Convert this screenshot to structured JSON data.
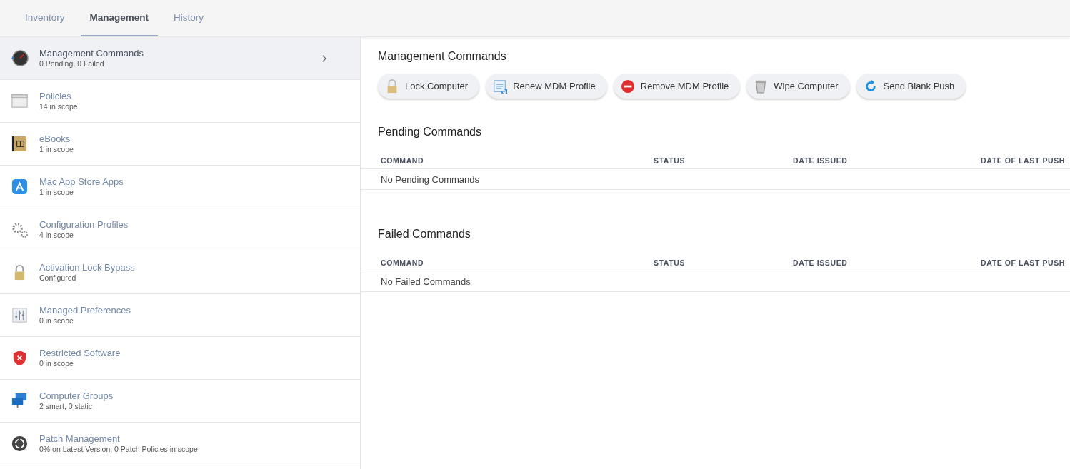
{
  "tabs": [
    {
      "label": "Inventory",
      "selected": false
    },
    {
      "label": "Management",
      "selected": true
    },
    {
      "label": "History",
      "selected": false
    }
  ],
  "sidebar": {
    "items": [
      {
        "kind": "commands",
        "title": "Management Commands",
        "subtitle": "0 Pending, 0 Failed",
        "selected": true
      },
      {
        "kind": "policies",
        "title": "Policies",
        "subtitle": "14 in scope",
        "selected": false
      },
      {
        "kind": "ebooks",
        "title": "eBooks",
        "subtitle": "1 in scope",
        "selected": false
      },
      {
        "kind": "appstore",
        "title": "Mac App Store Apps",
        "subtitle": "1 in scope",
        "selected": false
      },
      {
        "kind": "profiles",
        "title": "Configuration Profiles",
        "subtitle": "4 in scope",
        "selected": false
      },
      {
        "kind": "bypass",
        "title": "Activation Lock Bypass",
        "subtitle": "Configured",
        "selected": false
      },
      {
        "kind": "preferences",
        "title": "Managed Preferences",
        "subtitle": "0 in scope",
        "selected": false
      },
      {
        "kind": "restricted",
        "title": "Restricted Software",
        "subtitle": "0 in scope",
        "selected": false
      },
      {
        "kind": "groups",
        "title": "Computer Groups",
        "subtitle": "2 smart, 0 static",
        "selected": false
      },
      {
        "kind": "patch",
        "title": "Patch Management",
        "subtitle": "0% on Latest Version, 0 Patch Policies in scope",
        "selected": false
      }
    ]
  },
  "main": {
    "title": "Management Commands",
    "buttons": [
      {
        "kind": "lock",
        "label": "Lock Computer"
      },
      {
        "kind": "renew",
        "label": "Renew MDM Profile"
      },
      {
        "kind": "remove",
        "label": "Remove MDM Profile"
      },
      {
        "kind": "wipe",
        "label": "Wipe Computer"
      },
      {
        "kind": "push",
        "label": "Send Blank Push"
      }
    ],
    "sections": [
      {
        "title": "Pending Commands",
        "columns": [
          "COMMAND",
          "STATUS",
          "DATE ISSUED",
          "DATE OF LAST PUSH"
        ],
        "empty": "No Pending Commands"
      },
      {
        "title": "Failed Commands",
        "columns": [
          "COMMAND",
          "STATUS",
          "DATE ISSUED",
          "DATE OF LAST PUSH"
        ],
        "empty": "No Failed Commands"
      }
    ]
  }
}
